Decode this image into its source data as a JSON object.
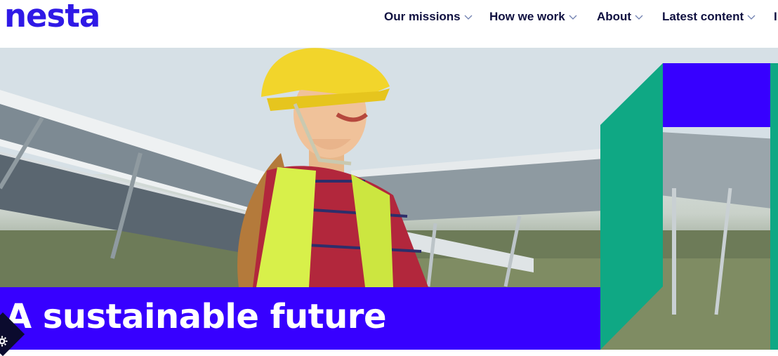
{
  "header": {
    "logo": "nesta",
    "nav": [
      {
        "label": "Our missions",
        "icon": "chevron-down-icon"
      },
      {
        "label": "How we work",
        "icon": "chevron-down-icon"
      },
      {
        "label": "About",
        "icon": "chevron-down-icon"
      },
      {
        "label": "Latest content",
        "icon": "chevron-down-icon"
      }
    ]
  },
  "hero": {
    "headline": "A sustainable future",
    "image": "woman-in-hard-hat-at-solar-farm"
  },
  "colors": {
    "brand": "#2f19e6",
    "headline_bg": "#3700ff",
    "accent_green": "#0fa884",
    "nav_text": "#0f1040"
  },
  "cookie_button": {
    "icon": "gear-icon"
  }
}
